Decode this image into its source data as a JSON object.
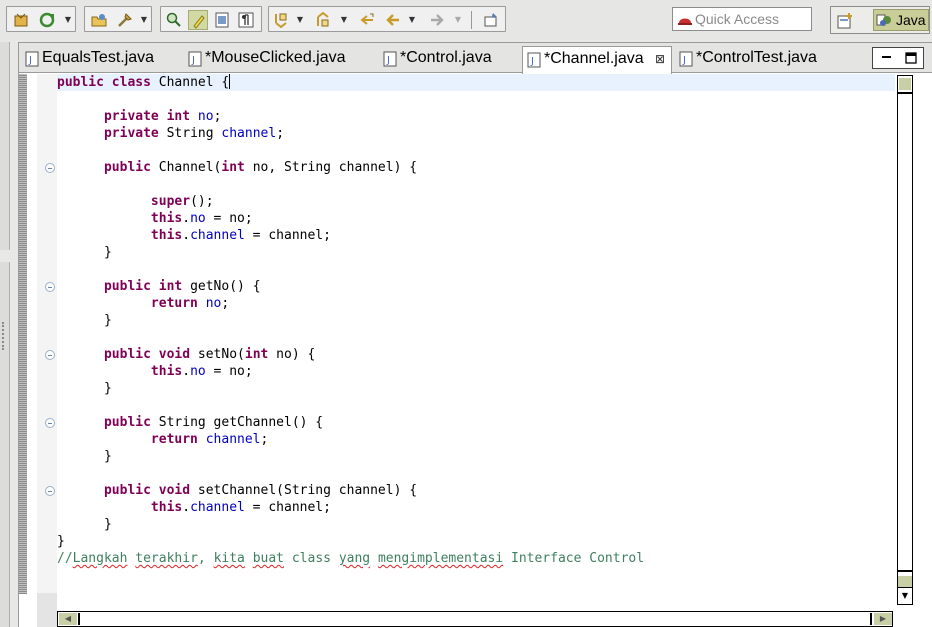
{
  "toolbar": {
    "quick_access_placeholder": "Quick Access",
    "perspective_label": "Java",
    "icons": [
      "new-wizard-icon",
      "run-history-icon",
      "open-type-icon",
      "debug-tools-icon",
      "search-icon",
      "highlight-icon",
      "toggle-block-icon",
      "show-whitespace-icon",
      "next-annotation-icon",
      "previous-annotation-icon",
      "back-icon",
      "forward-icon",
      "pin-editor-icon"
    ]
  },
  "tabs": [
    {
      "label": "EqualsTest.java",
      "active": false
    },
    {
      "label": "*MouseClicked.java",
      "active": false
    },
    {
      "label": "*Control.java",
      "active": false
    },
    {
      "label": "*Channel.java",
      "active": true
    },
    {
      "label": "*ControlTest.java",
      "active": false
    }
  ],
  "editor": {
    "close_glyph": "⊠",
    "lines": [
      {
        "text": "public class Channel {",
        "current": true
      },
      {
        "text": ""
      },
      {
        "text": "      private int no;"
      },
      {
        "text": "      private String channel;"
      },
      {
        "text": ""
      },
      {
        "text": "      public Channel(int no, String channel) {"
      },
      {
        "text": ""
      },
      {
        "text": "            super();"
      },
      {
        "text": "            this.no = no;"
      },
      {
        "text": "            this.channel = channel;"
      },
      {
        "text": "      }"
      },
      {
        "text": ""
      },
      {
        "text": "      public int getNo() {"
      },
      {
        "text": "            return no;"
      },
      {
        "text": "      }"
      },
      {
        "text": ""
      },
      {
        "text": "      public void setNo(int no) {"
      },
      {
        "text": "            this.no = no;"
      },
      {
        "text": "      }"
      },
      {
        "text": ""
      },
      {
        "text": "      public String getChannel() {"
      },
      {
        "text": "            return channel;"
      },
      {
        "text": "      }"
      },
      {
        "text": ""
      },
      {
        "text": "      public void setChannel(String channel) {"
      },
      {
        "text": "            this.channel = channel;"
      },
      {
        "text": "      }"
      },
      {
        "text": "}"
      },
      {
        "text": "//Langkah terakhir, kita buat class yang mengimplementasi Interface Control"
      }
    ]
  },
  "colors": {
    "keyword": "#7f0055",
    "field": "#0000c0",
    "comment": "#3f7f5f",
    "current_line": "#e8f2fe",
    "perspective_active": "#c9cd97"
  }
}
